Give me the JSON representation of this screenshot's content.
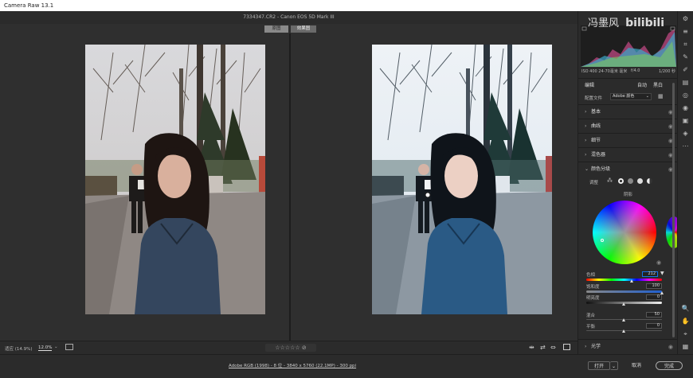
{
  "app": {
    "title": "Camera Raw 13.1"
  },
  "file": {
    "info": "7334347.CR2  -  Canon EOS 5D Mark III"
  },
  "view": {
    "before_label": "原图",
    "after_label": "效果图"
  },
  "watermark": {
    "text": "冯墨风",
    "logo_text": "bilibili"
  },
  "histogram": {
    "info_left": "ISO 400   24-70毫米 毫米",
    "info_mid": "f/4.0",
    "info_right": "1/200 秒"
  },
  "panel": {
    "edit_label": "编辑",
    "auto_label": "自动",
    "bw_label": "黑白",
    "profile_label": "配置文件",
    "profile_value": "Adobe 颜色",
    "sections": [
      {
        "label": "基本"
      },
      {
        "label": "曲线"
      },
      {
        "label": "细节"
      },
      {
        "label": "混色器"
      },
      {
        "label": "颜色分级"
      }
    ],
    "grading": {
      "adjust_label": "调整",
      "wheel_label": "阴影",
      "hue_label": "色相",
      "hue_value": "212",
      "sat_label": "饱和度",
      "sat_value": "100",
      "lum_label": "明亮度",
      "lum_value": "0",
      "blend_label": "混合",
      "blend_value": "50",
      "balance_label": "平衡",
      "balance_value": "0"
    },
    "optics_label": "光学"
  },
  "bottom": {
    "fit_label": "适应 (14.9%)",
    "zoom_value": "12.0%",
    "status_link": "Adobe RGB (1998) - 8 位 - 3840 x 5760 (22.1MP) - 300 ppi",
    "open_button": "打开",
    "cancel_button": "取消",
    "done_button": "完成",
    "rating": 0
  },
  "colors": {
    "accent": "#1473e6",
    "panel_bg": "#2b2b2b"
  }
}
